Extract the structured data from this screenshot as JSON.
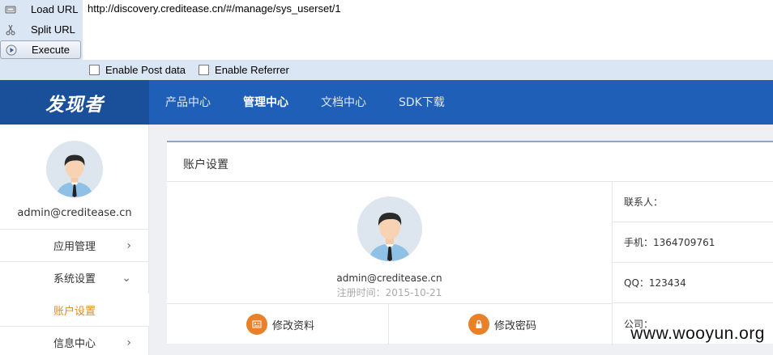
{
  "hackbar": {
    "buttons": [
      {
        "label": "Load URL",
        "icon": "load-url-icon"
      },
      {
        "label": "Split URL",
        "icon": "scissors-icon"
      },
      {
        "label": "Execute",
        "icon": "play-icon"
      }
    ],
    "url": "http://discovery.creditease.cn/#/manage/sys_userset/1",
    "options": [
      {
        "label": "Enable Post data",
        "checked": false
      },
      {
        "label": "Enable Referrer",
        "checked": false
      }
    ]
  },
  "nav": {
    "logo": "发现者",
    "items": [
      "产品中心",
      "管理中心",
      "文档中心",
      "SDK下载"
    ],
    "active_index": 1,
    "colors": {
      "bar": "#1f5fb8",
      "logo_bg": "#1a4f99"
    }
  },
  "sidebar": {
    "username": "admin@creditease.cn",
    "menu": [
      {
        "label": "应用管理",
        "chevron": "chevron-right-icon"
      },
      {
        "label": "系统设置",
        "chevron": "chevron-down-icon"
      },
      {
        "label": "账户设置",
        "active": true
      },
      {
        "label": "信息中心",
        "chevron": "chevron-right-icon"
      }
    ],
    "accent": "#e08a1e"
  },
  "panel": {
    "title": "账户设置",
    "username": "admin@creditease.cn",
    "register_time": "注册时间：2015-10-21",
    "actions": [
      {
        "label": "修改资料",
        "icon": "profile-card-icon"
      },
      {
        "label": "修改密码",
        "icon": "lock-icon"
      }
    ],
    "info": [
      "联系人：",
      "手机：1364709761",
      "QQ：123434",
      "公司："
    ]
  },
  "watermark": "www.wooyun.org"
}
